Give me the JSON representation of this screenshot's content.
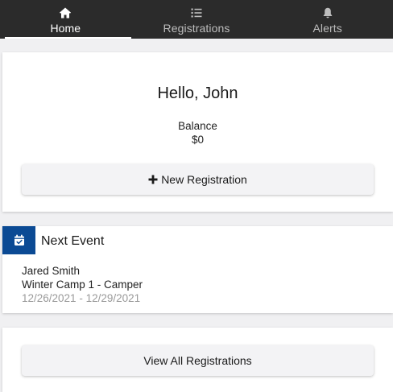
{
  "nav": {
    "tabs": [
      {
        "label": "Home",
        "icon": "home-icon",
        "active": true
      },
      {
        "label": "Registrations",
        "icon": "list-icon",
        "active": false
      },
      {
        "label": "Alerts",
        "icon": "bell-icon",
        "active": false
      }
    ]
  },
  "home": {
    "greeting": "Hello, John",
    "balance_label": "Balance",
    "balance_value": "$0",
    "new_registration_label": "New Registration"
  },
  "next_event": {
    "title": "Next Event",
    "person": "Jared Smith",
    "event_name": "Winter Camp 1 - Camper",
    "dates": "12/26/2021 - 12/29/2021"
  },
  "registrations": {
    "view_all_label": "View All Registrations"
  },
  "colors": {
    "nav_background": "#2b2b2b",
    "accent_badge": "#0b4a94",
    "page_background": "#f0f0f2"
  }
}
